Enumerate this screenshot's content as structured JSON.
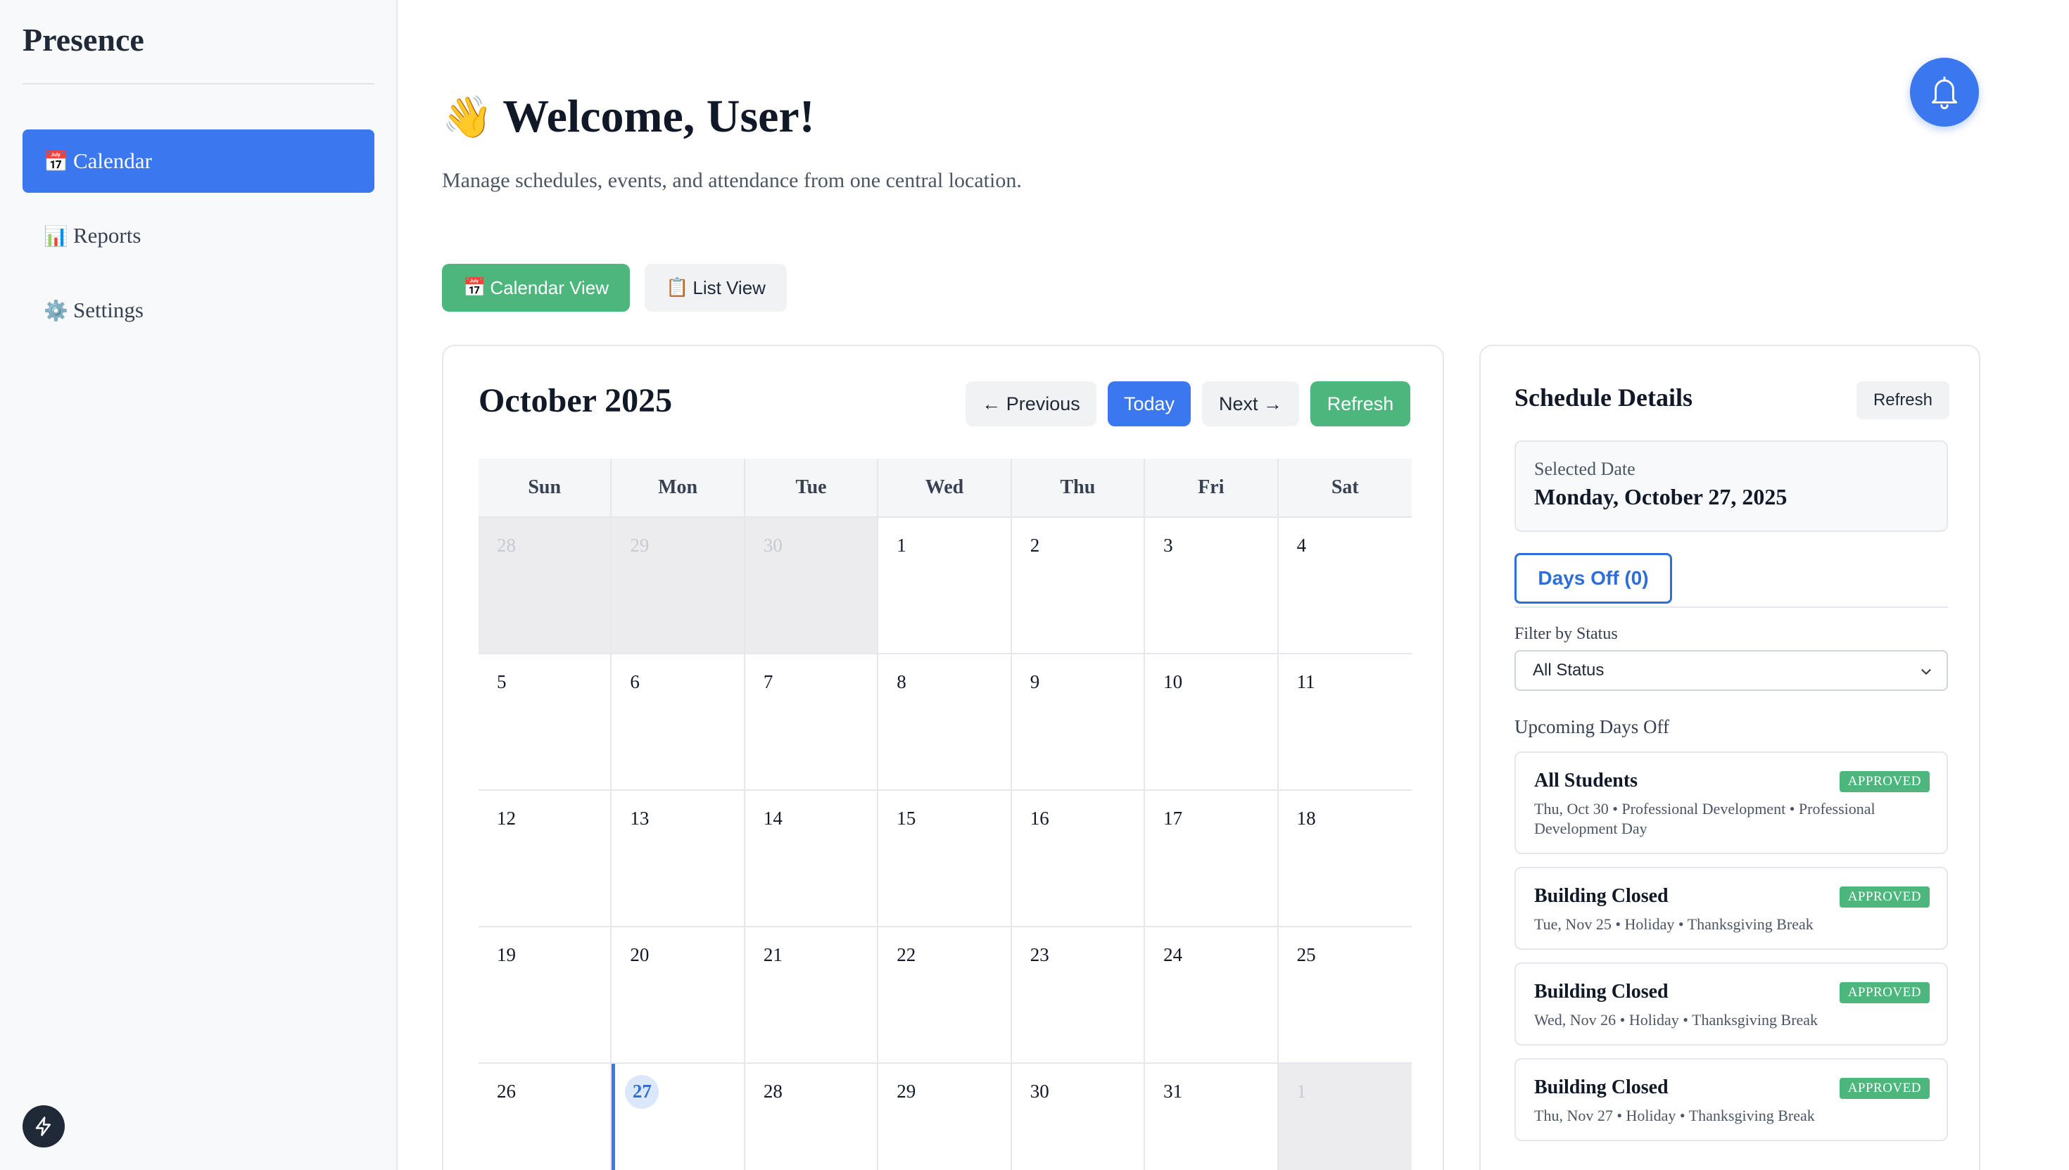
{
  "sidebar": {
    "brand": "Presence",
    "items": [
      {
        "icon": "calendar-icon",
        "emoji": "📅",
        "label": "Calendar",
        "active": true
      },
      {
        "icon": "bar-chart-icon",
        "emoji": "📊",
        "label": "Reports",
        "active": false
      },
      {
        "icon": "gear-icon",
        "emoji": "⚙️",
        "label": "Settings",
        "active": false
      }
    ]
  },
  "header": {
    "wave": "👋",
    "title": "Welcome, User!",
    "subtitle": "Manage schedules, events, and attendance from one central location."
  },
  "views": {
    "calendar": {
      "emoji": "📅",
      "label": "Calendar View"
    },
    "list": {
      "emoji": "📋",
      "label": "List View"
    }
  },
  "calendar": {
    "title": "October 2025",
    "prev_label": "← Previous",
    "today_label": "Today",
    "next_label": "Next →",
    "refresh_label": "Refresh",
    "weekdays": [
      "Sun",
      "Mon",
      "Tue",
      "Wed",
      "Thu",
      "Fri",
      "Sat"
    ],
    "weeks": [
      [
        "28",
        "29",
        "30",
        "1",
        "2",
        "3",
        "4"
      ],
      [
        "5",
        "6",
        "7",
        "8",
        "9",
        "10",
        "11"
      ],
      [
        "12",
        "13",
        "14",
        "15",
        "16",
        "17",
        "18"
      ],
      [
        "19",
        "20",
        "21",
        "22",
        "23",
        "24",
        "25"
      ],
      [
        "26",
        "27",
        "28",
        "29",
        "30",
        "31",
        "1"
      ]
    ]
  },
  "schedule": {
    "title": "Schedule Details",
    "refresh_label": "Refresh",
    "selected_label": "Selected Date",
    "selected_date": "Monday, October 27, 2025",
    "tab_label": "Days Off (0)",
    "filter_label": "Filter by Status",
    "filter_value": "All Status",
    "upcoming_label": "Upcoming Days Off",
    "events": [
      {
        "title": "All Students",
        "badge": "APPROVED",
        "meta": "Thu, Oct 30 • Professional Development • Professional Development Day"
      },
      {
        "title": "Building Closed",
        "badge": "APPROVED",
        "meta": "Tue, Nov 25 • Holiday • Thanksgiving Break"
      },
      {
        "title": "Building Closed",
        "badge": "APPROVED",
        "meta": "Wed, Nov 26 • Holiday • Thanksgiving Break"
      },
      {
        "title": "Building Closed",
        "badge": "APPROVED",
        "meta": "Thu, Nov 27 • Holiday • Thanksgiving Break"
      }
    ]
  },
  "colors": {
    "accent": "#3b78f0",
    "success": "#4cb67d",
    "border": "#e5e7eb"
  }
}
